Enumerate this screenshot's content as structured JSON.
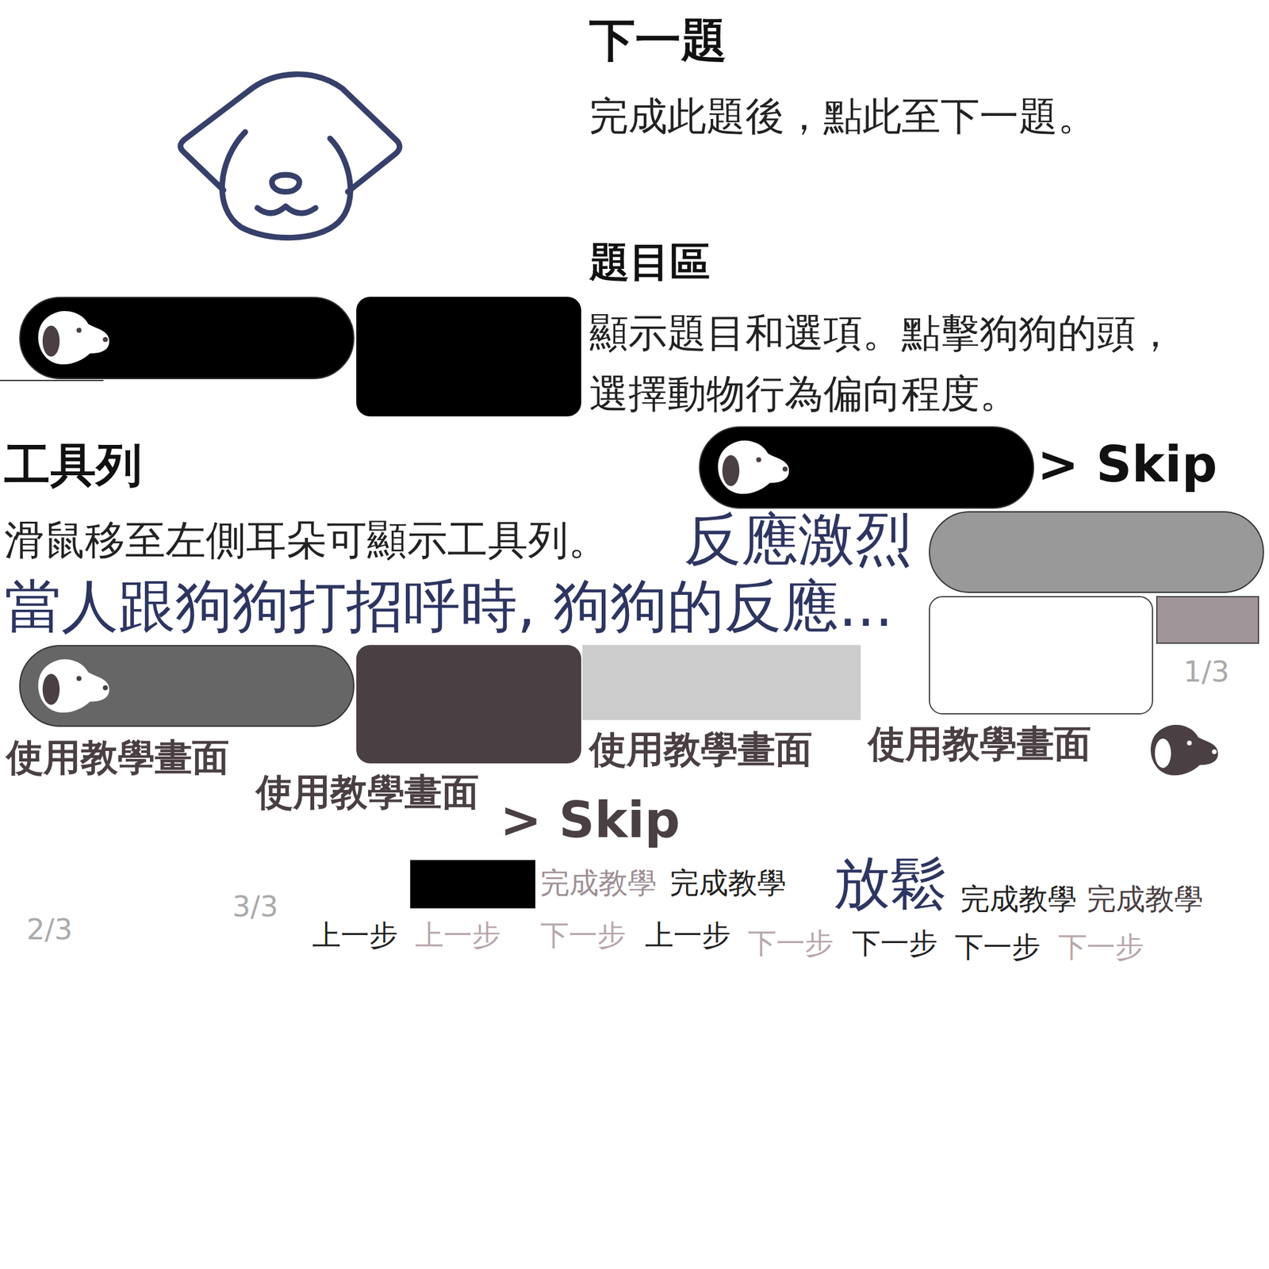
{
  "assets": [
    {
      "kind": "outline-dog",
      "color": "#36406a"
    },
    {
      "kind": "text",
      "text": "下一題",
      "color": "#111111"
    },
    {
      "kind": "text",
      "text": "完成此題後，點此至下一題。",
      "color": "#222222"
    },
    {
      "kind": "text",
      "text": "題目區",
      "color": "#111111"
    },
    {
      "kind": "pill",
      "color": "#000000"
    },
    {
      "kind": "line",
      "color": "#333333"
    },
    {
      "kind": "box",
      "color": "#000000"
    },
    {
      "kind": "text",
      "text": "顯示題目和選項。點擊狗狗的頭，",
      "color": "#222222"
    },
    {
      "kind": "text",
      "text": "選擇動物行為偏向程度。",
      "color": "#222222"
    },
    {
      "kind": "text",
      "text": "工具列",
      "color": "#111111"
    },
    {
      "kind": "pill",
      "color": "#000000"
    },
    {
      "kind": "text",
      "text": "> Skip",
      "color": "#111111"
    },
    {
      "kind": "text",
      "text": "滑鼠移至左側耳朵可顯示工具列。",
      "color": "#222222"
    },
    {
      "kind": "text",
      "text": "反應激烈",
      "color": "#2d3561"
    },
    {
      "kind": "bar",
      "color": "#999999"
    },
    {
      "kind": "text",
      "text": "當人跟狗狗打招呼時, 狗狗的反應...",
      "color": "#2d3561"
    },
    {
      "kind": "box",
      "color": "#ffffff"
    },
    {
      "kind": "rect",
      "color": "#a09598"
    },
    {
      "kind": "text",
      "text": "1/3",
      "color": "#aaaaaa"
    },
    {
      "kind": "pill",
      "color": "#666666"
    },
    {
      "kind": "box",
      "color": "#4a3f43"
    },
    {
      "kind": "rect",
      "color": "#cccccc"
    },
    {
      "kind": "text",
      "text": "使用教學畫面",
      "color": "#4a3f43"
    },
    {
      "kind": "text",
      "text": "使用教學畫面",
      "color": "#4a3f43"
    },
    {
      "kind": "text",
      "text": "使用教學畫面",
      "color": "#4a3f43"
    },
    {
      "kind": "text",
      "text": "使用教學畫面",
      "color": "#4a3f43"
    },
    {
      "kind": "dog",
      "color": "#4a3f43"
    },
    {
      "kind": "text",
      "text": "> Skip",
      "color": "#4a3f43"
    },
    {
      "kind": "rect",
      "color": "#000000"
    },
    {
      "kind": "text",
      "text": "完成教學",
      "color": "#9e8f94"
    },
    {
      "kind": "text",
      "text": "完成教學",
      "color": "#222222"
    },
    {
      "kind": "text",
      "text": "放鬆",
      "color": "#2d3561"
    },
    {
      "kind": "text",
      "text": "完成教學",
      "color": "#222222"
    },
    {
      "kind": "text",
      "text": "完成教學",
      "color": "#4a3f43"
    },
    {
      "kind": "text",
      "text": "2/3",
      "color": "#aaaaaa"
    },
    {
      "kind": "text",
      "text": "3/3",
      "color": "#aaaaaa"
    },
    {
      "kind": "text",
      "text": "上一步",
      "color": "#222222"
    },
    {
      "kind": "text",
      "text": "上一步",
      "color": "#b8a6ab"
    },
    {
      "kind": "text",
      "text": "下一步",
      "color": "#b8a6ab"
    },
    {
      "kind": "text",
      "text": "上一步",
      "color": "#222222"
    },
    {
      "kind": "text",
      "text": "下一步",
      "color": "#b8a6ab"
    },
    {
      "kind": "text",
      "text": "下一步",
      "color": "#222222"
    },
    {
      "kind": "text",
      "text": "下一步",
      "color": "#222222"
    },
    {
      "kind": "text",
      "text": "下一步",
      "color": "#b8a6ab"
    }
  ]
}
